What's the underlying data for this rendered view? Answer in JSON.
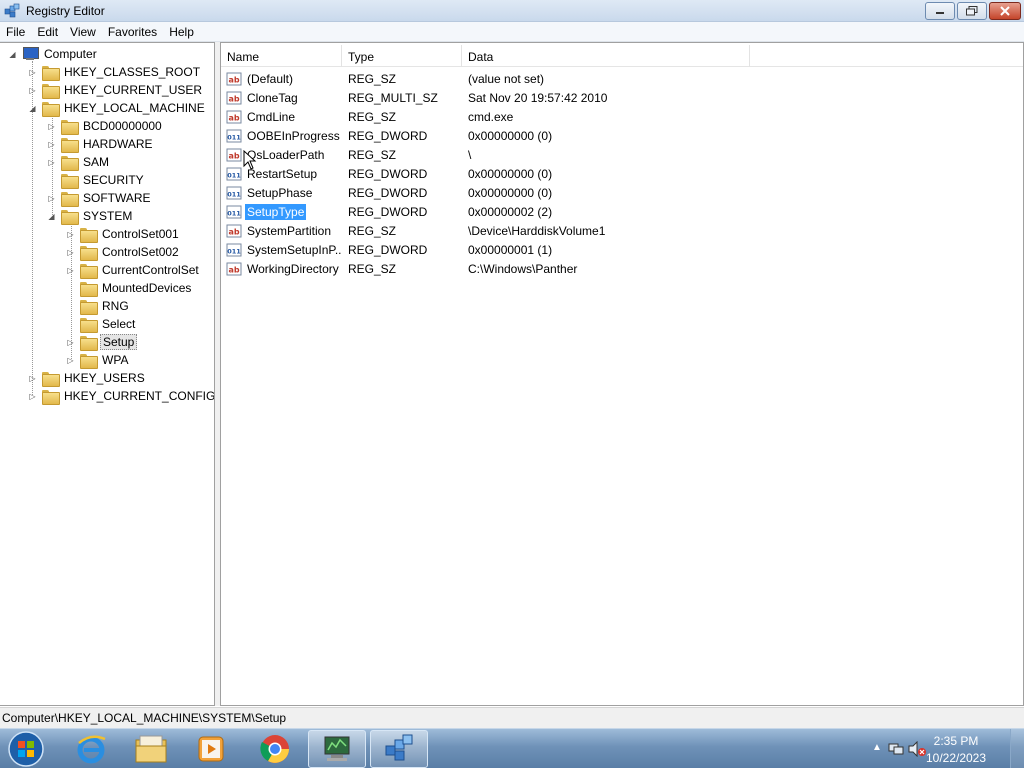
{
  "window": {
    "title": "Registry Editor"
  },
  "menu": [
    "File",
    "Edit",
    "View",
    "Favorites",
    "Help"
  ],
  "tree": {
    "root": "Computer",
    "items": [
      {
        "label": "HKEY_CLASSES_ROOT"
      },
      {
        "label": "HKEY_CURRENT_USER"
      },
      {
        "label": "HKEY_LOCAL_MACHINE"
      },
      {
        "label": "BCD00000000"
      },
      {
        "label": "HARDWARE"
      },
      {
        "label": "SAM"
      },
      {
        "label": "SECURITY"
      },
      {
        "label": "SOFTWARE"
      },
      {
        "label": "SYSTEM"
      },
      {
        "label": "ControlSet001"
      },
      {
        "label": "ControlSet002"
      },
      {
        "label": "CurrentControlSet"
      },
      {
        "label": "MountedDevices"
      },
      {
        "label": "RNG"
      },
      {
        "label": "Select"
      },
      {
        "label": "Setup"
      },
      {
        "label": "WPA"
      },
      {
        "label": "HKEY_USERS"
      },
      {
        "label": "HKEY_CURRENT_CONFIG"
      }
    ]
  },
  "list": {
    "columns": [
      "Name",
      "Type",
      "Data"
    ],
    "rows": [
      {
        "icon": "string-value-icon",
        "name": "(Default)",
        "type": "REG_SZ",
        "data": "(value not set)"
      },
      {
        "icon": "string-value-icon",
        "name": "CloneTag",
        "type": "REG_MULTI_SZ",
        "data": "Sat Nov 20 19:57:42 2010"
      },
      {
        "icon": "string-value-icon",
        "name": "CmdLine",
        "type": "REG_SZ",
        "data": "cmd.exe"
      },
      {
        "icon": "binary-value-icon",
        "name": "OOBEInProgress",
        "type": "REG_DWORD",
        "data": "0x00000000 (0)"
      },
      {
        "icon": "string-value-icon",
        "name": "OsLoaderPath",
        "type": "REG_SZ",
        "data": "\\"
      },
      {
        "icon": "binary-value-icon",
        "name": "RestartSetup",
        "type": "REG_DWORD",
        "data": "0x00000000 (0)"
      },
      {
        "icon": "binary-value-icon",
        "name": "SetupPhase",
        "type": "REG_DWORD",
        "data": "0x00000000 (0)"
      },
      {
        "icon": "binary-value-icon",
        "name": "SetupType",
        "type": "REG_DWORD",
        "data": "0x00000002 (2)",
        "selected": true
      },
      {
        "icon": "string-value-icon",
        "name": "SystemPartition",
        "type": "REG_SZ",
        "data": "\\Device\\HarddiskVolume1"
      },
      {
        "icon": "binary-value-icon",
        "name": "SystemSetupInP...",
        "type": "REG_DWORD",
        "data": "0x00000001 (1)"
      },
      {
        "icon": "string-value-icon",
        "name": "WorkingDirectory",
        "type": "REG_SZ",
        "data": "C:\\Windows\\Panther"
      }
    ]
  },
  "status": {
    "path": "Computer\\HKEY_LOCAL_MACHINE\\SYSTEM\\Setup"
  },
  "taskbar": {
    "apps": [
      "start-orb-icon",
      "internet-explorer-icon",
      "file-explorer-icon",
      "media-player-icon",
      "chrome-icon",
      "network-tool-icon",
      "registry-editor-icon"
    ],
    "clock": {
      "time": "2:35 PM",
      "date": "10/22/2023"
    }
  },
  "colors": {
    "selection": "#3399ff",
    "taskbar": "#6f92b8"
  }
}
